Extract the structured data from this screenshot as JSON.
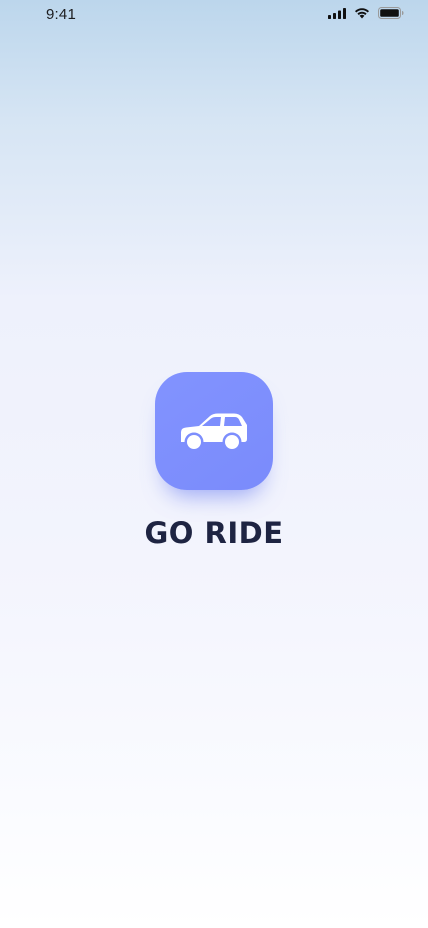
{
  "status_bar": {
    "time": "9:41",
    "icons": [
      "cellular-signal-icon",
      "wifi-icon",
      "battery-icon"
    ]
  },
  "splash": {
    "logo_icon": "car-icon",
    "app_name": "GO RIDE"
  },
  "colors": {
    "accent": "#7d8efd",
    "title_text": "#1e2442",
    "background_top": "#bcd6ec",
    "background_bottom": "#ffffff"
  }
}
